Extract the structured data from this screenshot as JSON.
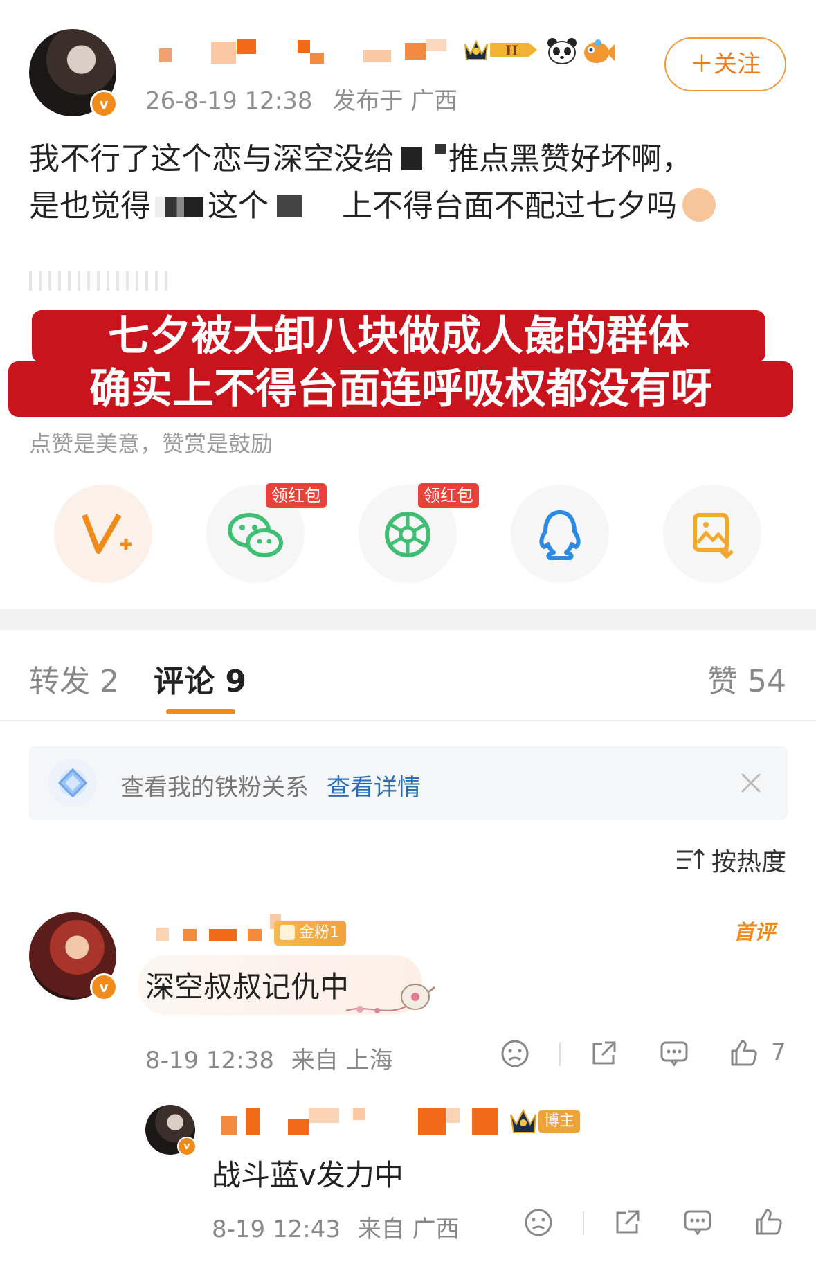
{
  "post": {
    "timestamp": "26-8-19 12:38",
    "location": "发布于 广西",
    "follow_label": "＋关注",
    "line1_a": "我不行了这个恋与深空没给",
    "line1_b": "推点黑赞好坏啊，",
    "line2_a": "是也觉得",
    "line2_b": "这个",
    "line2_c": "上不得台面不配过七夕吗",
    "banner_line1": "七夕被大卸八块做成人彘的群体",
    "banner_line2": "确实上不得台面连呼吸权都没有呀",
    "reward_hint": "点赞是美意，赞赏是鼓励",
    "badge_level": "II"
  },
  "share": {
    "red_packet_label_1": "领红包",
    "red_packet_label_2": "领红包",
    "icons": [
      "v-plus-icon",
      "wechat-icon",
      "moments-icon",
      "qq-icon",
      "save-image-icon"
    ]
  },
  "tabs": {
    "repost": "转发 2",
    "comments": "评论 9",
    "likes": "赞 54"
  },
  "fan_banner": {
    "text": "查看我的铁粉关系",
    "link": "查看详情"
  },
  "sort": {
    "label": "按热度"
  },
  "comments": [
    {
      "fan_badge": "金粉1",
      "first_badge": "首评",
      "text": "深空叔叔记仇中",
      "time": "8-19 12:38",
      "source": "来自 上海",
      "likes": "7"
    }
  ],
  "reply": {
    "host_badge": "博主",
    "text": "战斗蓝v发力中",
    "time": "8-19 12:43",
    "source": "来自 广西"
  },
  "colors": {
    "accent_orange": "#f07a1a",
    "banner_red": "#c9141e",
    "link_blue": "#2a6db5"
  }
}
